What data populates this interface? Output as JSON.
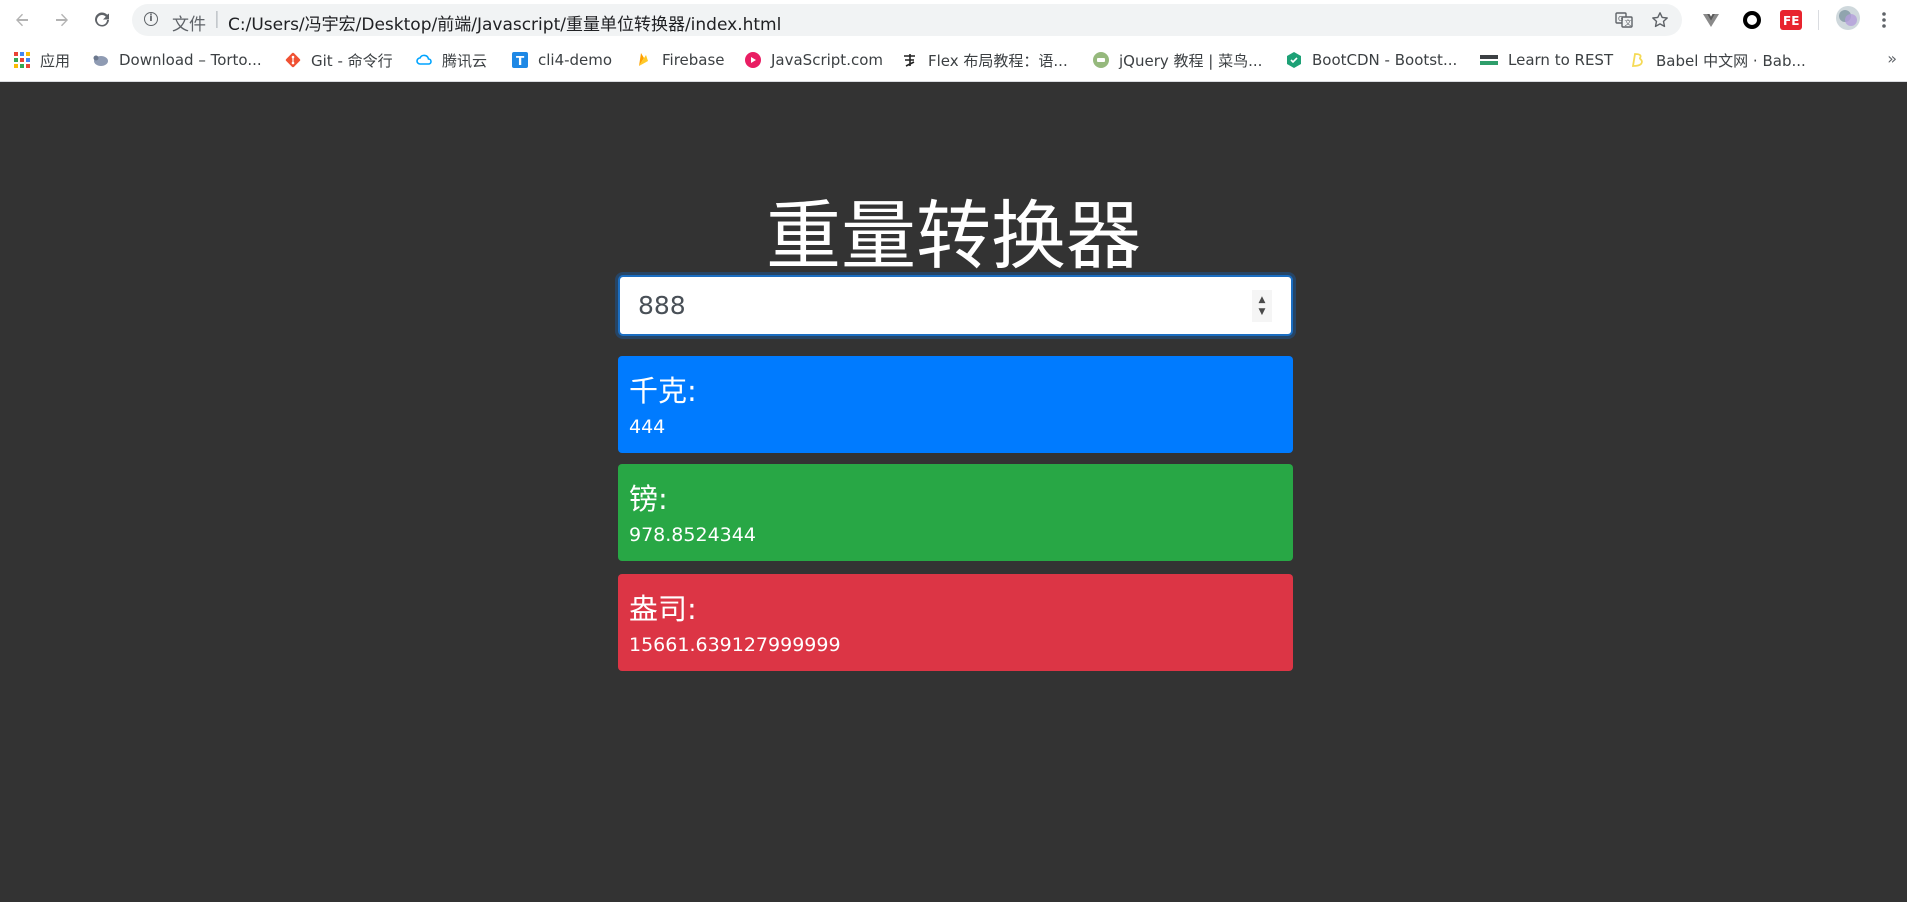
{
  "browser": {
    "security_label": "文件",
    "separator": "|",
    "url": "C:/Users/冯宇宏/Desktop/前端/Javascript/重量单位转换器/index.html",
    "bookmarks": [
      {
        "label": "应用",
        "icon": "apps-grid-icon"
      },
      {
        "label": "Download – Torto...",
        "icon": "tortoise-icon"
      },
      {
        "label": "Git - 命令行",
        "icon": "git-icon"
      },
      {
        "label": "腾讯云",
        "icon": "cloud-icon"
      },
      {
        "label": "cli4-demo",
        "icon": "t-icon"
      },
      {
        "label": "Firebase",
        "icon": "firebase-icon"
      },
      {
        "label": "JavaScript.com",
        "icon": "javascript-icon"
      },
      {
        "label": "Flex 布局教程：语...",
        "icon": "calligraphy-icon"
      },
      {
        "label": "jQuery 教程 | 菜鸟...",
        "icon": "runoob-icon"
      },
      {
        "label": "BootCDN - Bootst...",
        "icon": "bootcdn-icon"
      },
      {
        "label": "Learn to REST",
        "icon": "rest-icon"
      },
      {
        "label": "Babel 中文网 · Bab...",
        "icon": "babel-icon"
      }
    ],
    "more_label": "»"
  },
  "page": {
    "title": "重量转换器",
    "input_value": "888",
    "cards": [
      {
        "title": "千克:",
        "value": "444",
        "color": "#007bff"
      },
      {
        "title": "镑:",
        "value": "978.8524344",
        "color": "#28a745"
      },
      {
        "title": "盎司:",
        "value": "15661.639127999999",
        "color": "#dc3545"
      }
    ]
  }
}
